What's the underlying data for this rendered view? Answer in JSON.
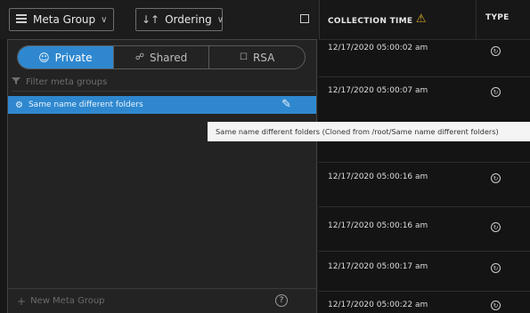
{
  "toolbar": {
    "meta_group_label": "Meta Group",
    "ordering_label": "Ordering"
  },
  "tabs": [
    {
      "label": "Private",
      "active": true
    },
    {
      "label": "Shared",
      "active": false
    },
    {
      "label": "RSA",
      "active": false
    }
  ],
  "filter_placeholder": "Filter meta groups",
  "selected_group": "Same name different folders",
  "footer": {
    "new_label": "New Meta Group",
    "help_symbol": "?"
  },
  "table": {
    "col_time": "COLLECTION TIME",
    "col_type": "TYPE",
    "rows": [
      {
        "time": "12/17/2020 05:00:02 am"
      },
      {
        "time": "12/17/2020 05:00:07 am"
      },
      {
        "time": "12/17/2020 05:00:16 am"
      },
      {
        "time": "12/17/2020 05:00:16 am"
      },
      {
        "time": "12/17/2020 05:00:17 am"
      },
      {
        "time": "12/17/2020 05:00:22 am"
      }
    ]
  },
  "tooltip": "Same name different folders (Cloned from /root/Same name different folders)",
  "colors": {
    "accent": "#2f88cf",
    "warning": "#e0b02a"
  }
}
